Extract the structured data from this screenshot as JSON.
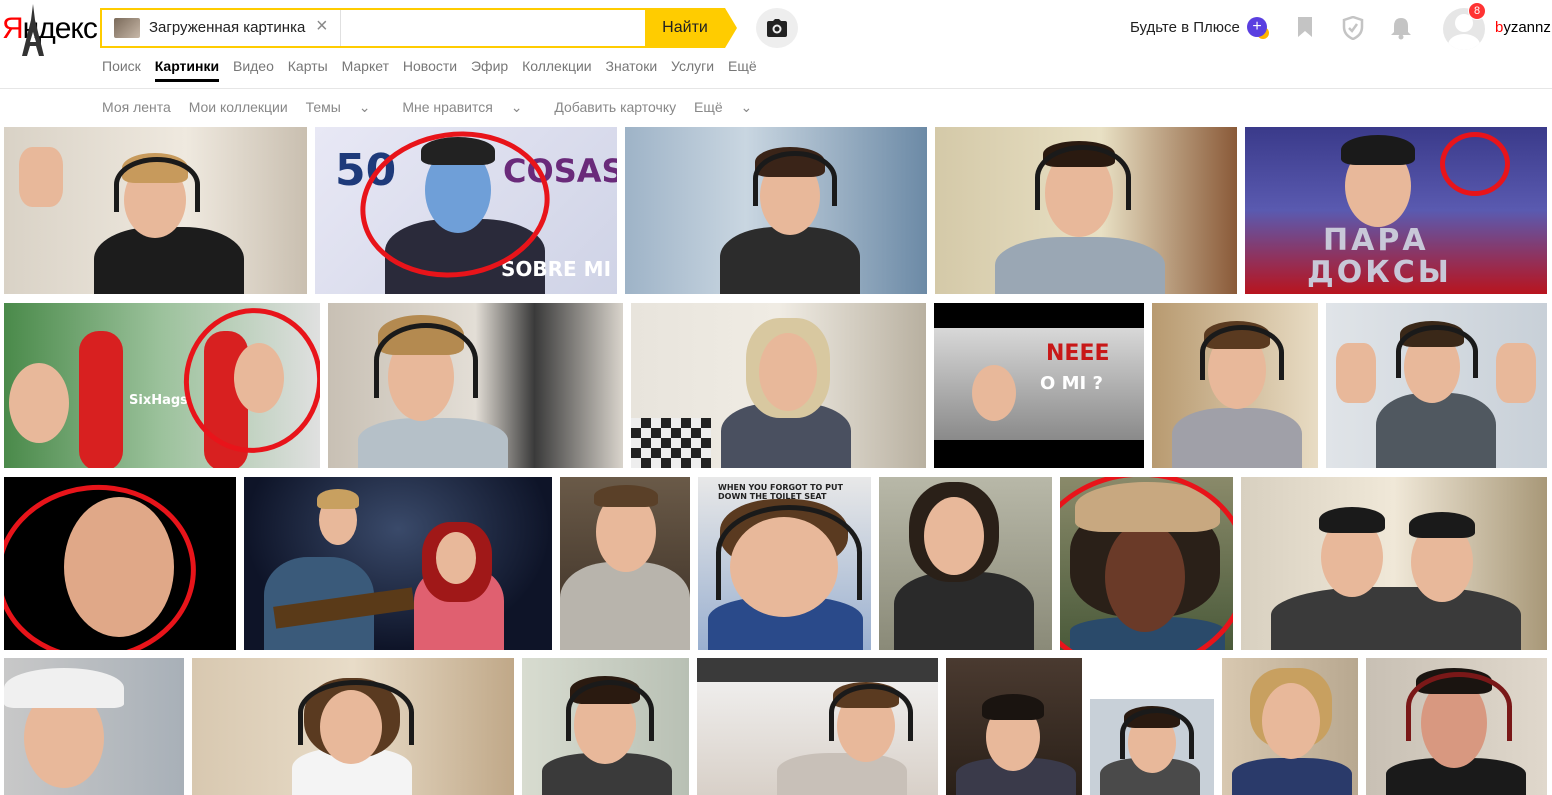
{
  "logo": {
    "first_letter": "Я",
    "rest": "ндекс"
  },
  "search": {
    "chip_label": "Загруженная картинка",
    "query": "",
    "find_label": "Найти"
  },
  "header": {
    "plus_label": "Будьте в Плюсе",
    "notifications_count": "8",
    "username_first": "b",
    "username_rest": "yzannz"
  },
  "services": {
    "items": [
      "Поиск",
      "Картинки",
      "Видео",
      "Карты",
      "Маркет",
      "Новости",
      "Эфир",
      "Коллекции",
      "Знатоки",
      "Услуги",
      "Ещё"
    ],
    "active": "Картинки"
  },
  "subnav": {
    "items": [
      "Моя лента",
      "Мои коллекции",
      "Темы",
      "Мне нравится",
      "Добавить карточку",
      "Ещё"
    ]
  },
  "thumb_text": {
    "t2_50": "50",
    "t2_cosas": "COSAS",
    "t2_sobre": "SOBRE MI",
    "t5_para": "ПАРА",
    "t5_doksy": "ДОКСЫ",
    "t6_sixflags": "SixHags",
    "t9_neee": "NEEE",
    "t9_omi": "O MI ?",
    "t15_caption": "WHEN YOU FORGOT TO PUT DOWN THE TOILET SEAT"
  },
  "colors": {
    "accent_yellow": "#ffcc00",
    "annotation_red": "#e8141a",
    "brand_red": "#ff0000"
  }
}
